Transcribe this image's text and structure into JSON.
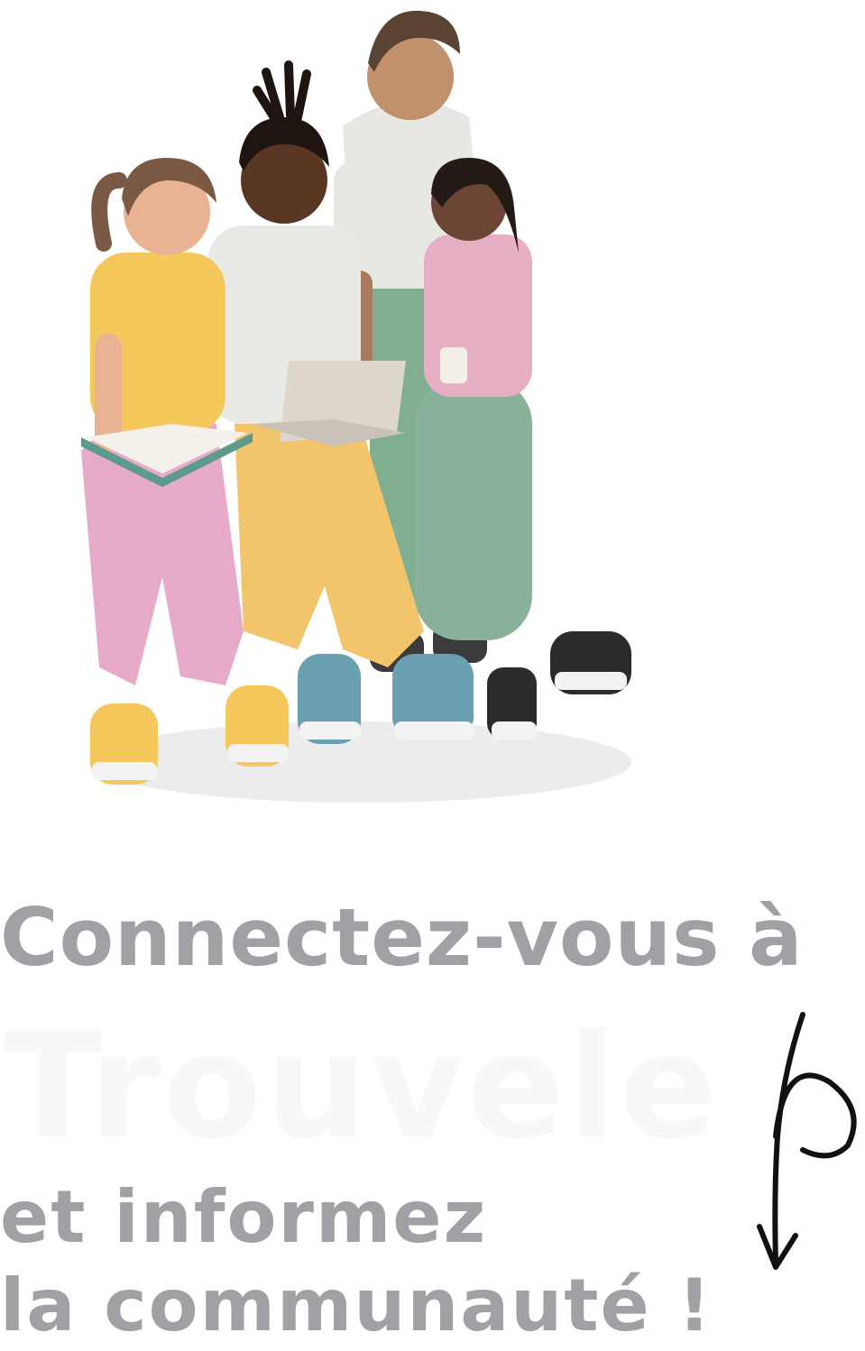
{
  "hero": {
    "image_name": "group-of-people-with-laptop-and-book-illustration"
  },
  "headline": {
    "line1": "Connectez-vous à",
    "brand": "Trouvele",
    "line2": "et informez",
    "line3": "la communauté !"
  },
  "colors": {
    "headline_text": "#a0a0a5",
    "brand_text": "#f8f8f8",
    "background": "#ffffff"
  },
  "icons": {
    "scroll_indicator": "hand-drawn-arrow-down-icon"
  }
}
